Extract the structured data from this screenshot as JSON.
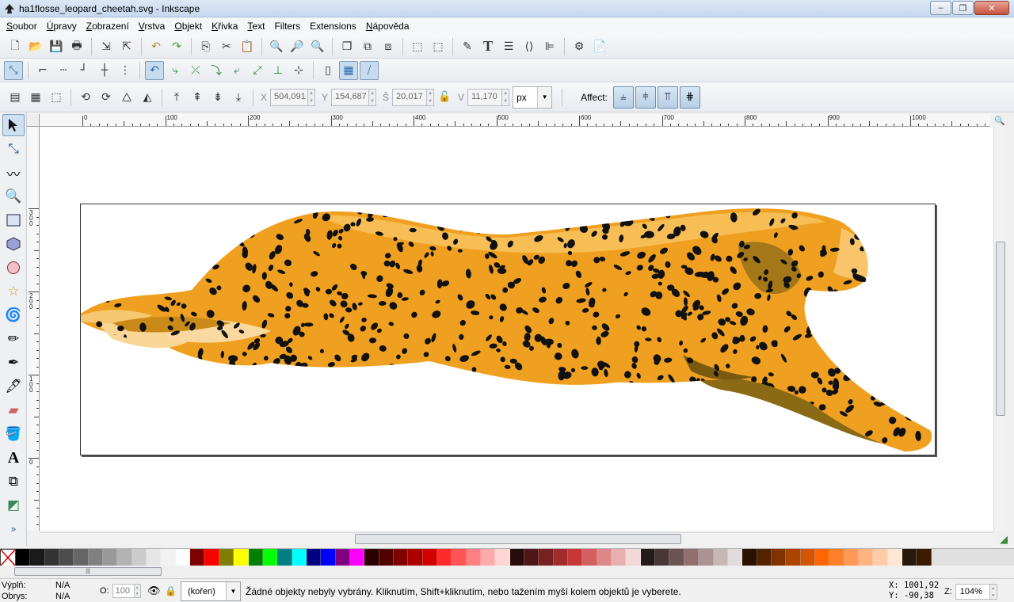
{
  "window": {
    "title": "ha1flosse_leopard_cheetah.svg - Inkscape",
    "minimize": "‒",
    "maximize": "❐",
    "close": "✕"
  },
  "menu": [
    {
      "label": "Soubor",
      "u": "S",
      "rest": "oubor"
    },
    {
      "label": "Úpravy",
      "u": "Ú",
      "rest": "pravy"
    },
    {
      "label": "Zobrazení",
      "u": "Z",
      "rest": "obrazení"
    },
    {
      "label": "Vrstva",
      "u": "V",
      "rest": "rstva"
    },
    {
      "label": "Objekt",
      "u": "O",
      "rest": "bjekt"
    },
    {
      "label": "Křivka",
      "u": "K",
      "rest": "řivka"
    },
    {
      "label": "Text",
      "u": "T",
      "rest": "ext"
    },
    {
      "label": "Filters",
      "u": "",
      "rest": "Filters"
    },
    {
      "label": "Extensions",
      "u": "",
      "rest": "Extensions"
    },
    {
      "label": "Nápověda",
      "u": "N",
      "rest": "ápověda"
    }
  ],
  "toolctrl": {
    "x_label": "X",
    "x_value": "504,091",
    "y_label": "Y",
    "y_value": "154,687",
    "w_label": "Š",
    "w_value": "20,017",
    "h_label": "V",
    "h_value": "11,170",
    "unit": "px",
    "affect_label": "Affect:"
  },
  "rulers": {
    "h_labels": [
      "0",
      "100",
      "200",
      "300",
      "400",
      "500",
      "600",
      "700",
      "800",
      "900",
      "1000"
    ],
    "v_labels": [
      "300",
      "200",
      "100",
      "0"
    ]
  },
  "status": {
    "fill_label": "Výplň:",
    "fill_value": "N/A",
    "stroke_label": "Obrys:",
    "stroke_value": "N/A",
    "opacity_label": "O:",
    "opacity_value": "100",
    "layer": "(kořen)",
    "message": "Žádné objekty nebyly vybrány. Kliknutím, Shift+kliknutím, nebo tažením myší kolem objektů je vyberete.",
    "x_coord": "X: 1001,92",
    "y_coord": "Y:  -90,38",
    "zoom_label": "Z:",
    "zoom_value": "104%"
  },
  "palette": [
    "#000000",
    "#1a1a1a",
    "#333333",
    "#4d4d4d",
    "#666666",
    "#808080",
    "#999999",
    "#b3b3b3",
    "#cccccc",
    "#e6e6e6",
    "#f2f2f2",
    "#ffffff",
    "#800000",
    "#ff0000",
    "#808000",
    "#ffff00",
    "#008000",
    "#00ff00",
    "#008080",
    "#00ffff",
    "#000080",
    "#0000ff",
    "#800080",
    "#ff00ff",
    "#2b0000",
    "#550000",
    "#800000",
    "#aa0000",
    "#d40000",
    "#ff2a2a",
    "#ff5555",
    "#ff8080",
    "#ffaaaa",
    "#ffd5d5",
    "#280b0b",
    "#501616",
    "#782121",
    "#a02c2c",
    "#c83737",
    "#d35f5f",
    "#de8787",
    "#e9afaf",
    "#f4d7d7",
    "#241c1c",
    "#483737",
    "#6c5353",
    "#916f6f",
    "#ac9393",
    "#c8b7b7",
    "#e3dbdb",
    "#2b1100",
    "#552200",
    "#803300",
    "#aa4400",
    "#d45500",
    "#ff6600",
    "#ff7f2a",
    "#ff9955",
    "#ffb380",
    "#ffccaa",
    "#ffe6d5",
    "#281a0b",
    "#3b1a03"
  ]
}
